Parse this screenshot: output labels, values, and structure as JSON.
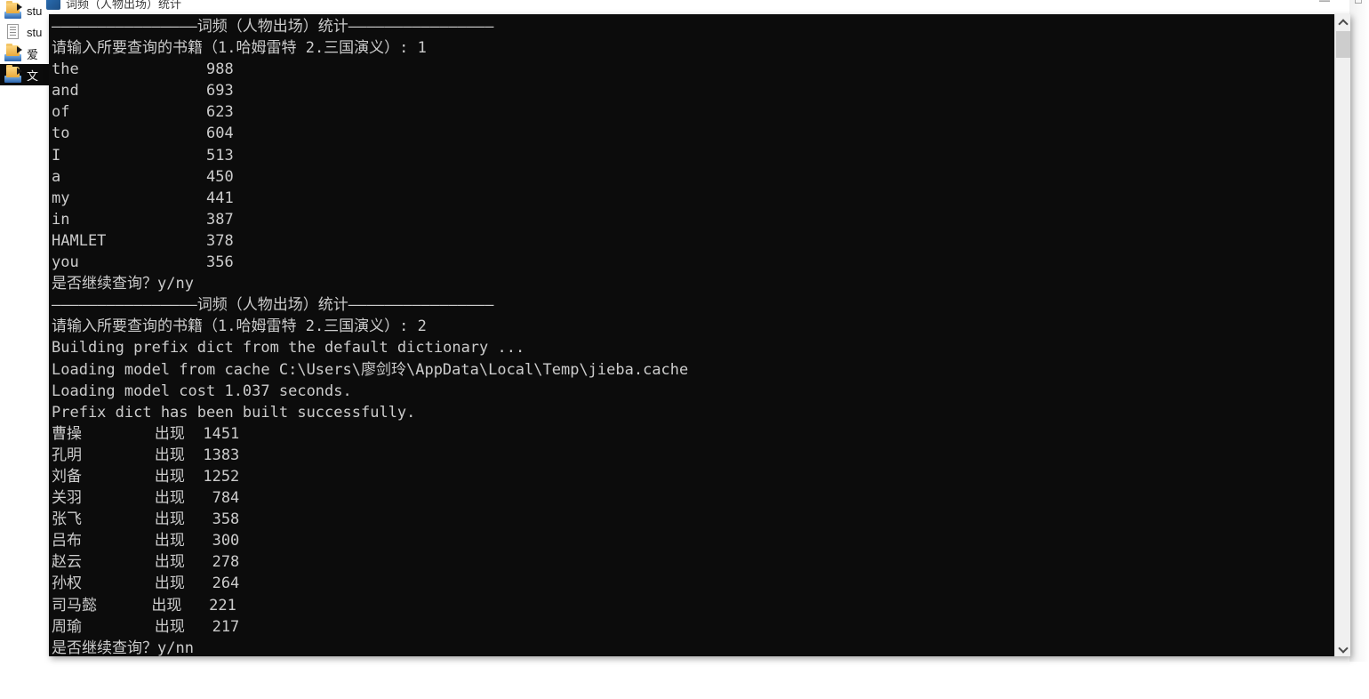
{
  "window": {
    "background_app_title": "词频（人物出场）统计",
    "minimize_label": "—",
    "maximize_label": "□",
    "console_title": "词频（人物出场）统计"
  },
  "desktop_icons": [
    {
      "label": "stu",
      "icon": "shortcut-icon",
      "selected": false
    },
    {
      "label": "stu",
      "icon": "text-document-icon",
      "selected": false
    },
    {
      "label": "爱",
      "icon": "shortcut-icon",
      "selected": false
    },
    {
      "label": "文",
      "icon": "shortcut-icon",
      "selected": true
    }
  ],
  "scrollbar": {
    "up_arrow": "▲",
    "down_arrow": "▼"
  },
  "console": {
    "separator": "————————————————词频（人物出场）统计————————————————",
    "prompt_book": "请输入所要查询的书籍（1.哈姆雷特 2.三国演义）: ",
    "continue_prompt": "是否继续查询？y/n",
    "session1": {
      "input": "1",
      "answer": "y",
      "rows": [
        {
          "word": "the",
          "count": "988"
        },
        {
          "word": "and",
          "count": "693"
        },
        {
          "word": "of",
          "count": "623"
        },
        {
          "word": "to",
          "count": "604"
        },
        {
          "word": "I",
          "count": "513"
        },
        {
          "word": "a",
          "count": "450"
        },
        {
          "word": "my",
          "count": "441"
        },
        {
          "word": "in",
          "count": "387"
        },
        {
          "word": "HAMLET",
          "count": "378"
        },
        {
          "word": "you",
          "count": "356"
        }
      ]
    },
    "session2": {
      "input": "2",
      "answer": "n",
      "jieba_messages": [
        "Building prefix dict from the default dictionary ...",
        "Loading model from cache C:\\Users\\廖剑玲\\AppData\\Local\\Temp\\jieba.cache",
        "Loading model cost 1.037 seconds.",
        "Prefix dict has been built successfully."
      ],
      "occurrence_label": "出现",
      "rows": [
        {
          "name": "曹操",
          "count": "1451"
        },
        {
          "name": "孔明",
          "count": "1383"
        },
        {
          "name": "刘备",
          "count": "1252"
        },
        {
          "name": "关羽",
          "count": "784"
        },
        {
          "name": "张飞",
          "count": "358"
        },
        {
          "name": "吕布",
          "count": "300"
        },
        {
          "name": "赵云",
          "count": "278"
        },
        {
          "name": "孙权",
          "count": "264"
        },
        {
          "name": "司马懿",
          "count": "221"
        },
        {
          "name": "周瑜",
          "count": "217"
        }
      ]
    }
  },
  "colors": {
    "console_bg": "#0c0c0c",
    "console_fg": "#cccccc",
    "desktop_bg": "#ffffff",
    "scrollbar_track": "#f0f0f0",
    "scrollbar_thumb": "#cdcdcd"
  }
}
